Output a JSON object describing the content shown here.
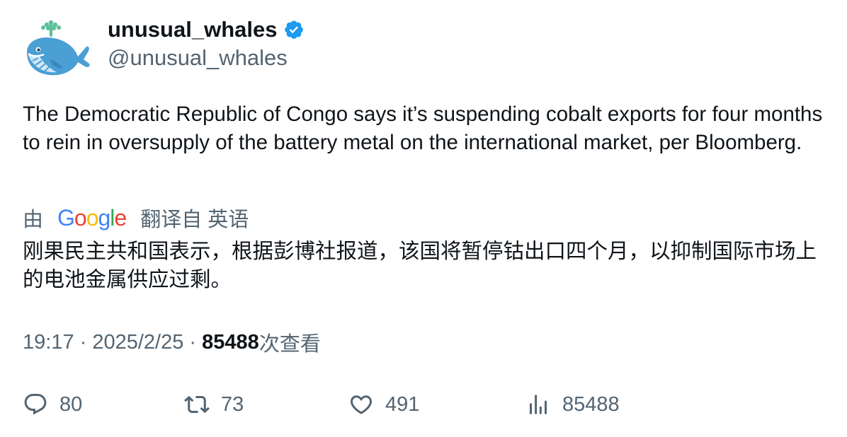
{
  "author": {
    "display_name": "unusual_whales",
    "handle": "@unusual_whales",
    "verified": true,
    "avatar_icon": "whale-avatar-icon",
    "verified_icon": "verified-badge-icon"
  },
  "tweet": {
    "text": "The Democratic Republic of Congo says it’s suspending cobalt exports for four months to rein in oversupply of the battery metal on the international market, per Bloomberg.",
    "translation": {
      "prefix": "由",
      "provider_letters": [
        "G",
        "o",
        "o",
        "g",
        "l",
        "e"
      ],
      "suffix": "翻译自 英语",
      "text": "刚果民主共和国表示，根据彭博社报道，该国将暂停钴出口四个月，以抑制国际市场上的电池金属供应过剩。"
    },
    "time": "19:17",
    "separator": " · ",
    "date": "2025/2/25",
    "views_count": "85488",
    "views_label": "次查看"
  },
  "actions": {
    "replies": "80",
    "retweets": "73",
    "likes": "491",
    "views": "85488"
  },
  "colors": {
    "text": "#0f1419",
    "secondary": "#536471",
    "verified": "#1d9bf0"
  }
}
